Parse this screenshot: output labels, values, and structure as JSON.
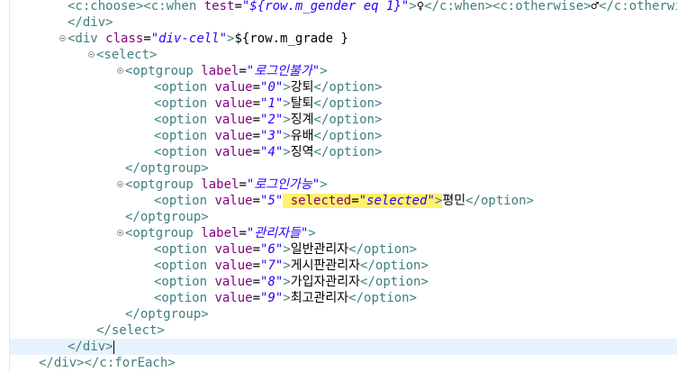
{
  "editor": {
    "lines": [
      {
        "segments": [
          {
            "t": "tag",
            "v": "<c:choose><c:when "
          },
          {
            "t": "attr",
            "v": "test"
          },
          {
            "t": "txt",
            "v": "="
          },
          {
            "t": "val",
            "v": "\"${row.m_gender eq 1}\""
          },
          {
            "t": "tag",
            "v": ">"
          },
          {
            "t": "txt",
            "v": "♀"
          },
          {
            "t": "tag",
            "v": "</c:when><c:otherwise>"
          },
          {
            "t": "txt",
            "v": "♂"
          },
          {
            "t": "tag",
            "v": "</c:otherwise>"
          }
        ]
      },
      {
        "segments": [
          {
            "t": "tag",
            "v": "</div>"
          }
        ]
      },
      {
        "segments": [
          {
            "t": "tag",
            "v": "<div "
          },
          {
            "t": "attr",
            "v": "class"
          },
          {
            "t": "txt",
            "v": "="
          },
          {
            "t": "val",
            "v": "\"div-cell\""
          },
          {
            "t": "tag",
            "v": ">"
          },
          {
            "t": "txt",
            "v": "${row.m_grade }"
          }
        ]
      },
      {
        "segments": [
          {
            "t": "tag",
            "v": "<select>"
          }
        ]
      },
      {
        "segments": [
          {
            "t": "tag",
            "v": "<optgroup "
          },
          {
            "t": "attr",
            "v": "label"
          },
          {
            "t": "txt",
            "v": "="
          },
          {
            "t": "val",
            "v": "\"로그인불가\""
          },
          {
            "t": "tag",
            "v": ">"
          }
        ]
      },
      {
        "segments": [
          {
            "t": "tag",
            "v": "<option "
          },
          {
            "t": "attr",
            "v": "value"
          },
          {
            "t": "txt",
            "v": "="
          },
          {
            "t": "val",
            "v": "\"0\""
          },
          {
            "t": "tag",
            "v": ">"
          },
          {
            "t": "txt",
            "v": "강퇴"
          },
          {
            "t": "tag",
            "v": "</option>"
          }
        ]
      },
      {
        "segments": [
          {
            "t": "tag",
            "v": "<option "
          },
          {
            "t": "attr",
            "v": "value"
          },
          {
            "t": "txt",
            "v": "="
          },
          {
            "t": "val",
            "v": "\"1\""
          },
          {
            "t": "tag",
            "v": ">"
          },
          {
            "t": "txt",
            "v": "탈퇴"
          },
          {
            "t": "tag",
            "v": "</option>"
          }
        ]
      },
      {
        "segments": [
          {
            "t": "tag",
            "v": "<option "
          },
          {
            "t": "attr",
            "v": "value"
          },
          {
            "t": "txt",
            "v": "="
          },
          {
            "t": "val",
            "v": "\"2\""
          },
          {
            "t": "tag",
            "v": ">"
          },
          {
            "t": "txt",
            "v": "징계"
          },
          {
            "t": "tag",
            "v": "</option>"
          }
        ]
      },
      {
        "segments": [
          {
            "t": "tag",
            "v": "<option "
          },
          {
            "t": "attr",
            "v": "value"
          },
          {
            "t": "txt",
            "v": "="
          },
          {
            "t": "val",
            "v": "\"3\""
          },
          {
            "t": "tag",
            "v": ">"
          },
          {
            "t": "txt",
            "v": "유배"
          },
          {
            "t": "tag",
            "v": "</option>"
          }
        ]
      },
      {
        "segments": [
          {
            "t": "tag",
            "v": "<option "
          },
          {
            "t": "attr",
            "v": "value"
          },
          {
            "t": "txt",
            "v": "="
          },
          {
            "t": "val",
            "v": "\"4\""
          },
          {
            "t": "tag",
            "v": ">"
          },
          {
            "t": "txt",
            "v": "징역"
          },
          {
            "t": "tag",
            "v": "</option>"
          }
        ]
      },
      {
        "segments": [
          {
            "t": "tag",
            "v": "</optgroup>"
          }
        ]
      },
      {
        "segments": [
          {
            "t": "tag",
            "v": "<optgroup "
          },
          {
            "t": "attr",
            "v": "label"
          },
          {
            "t": "txt",
            "v": "="
          },
          {
            "t": "val",
            "v": "\"로그인가능\""
          },
          {
            "t": "tag",
            "v": ">"
          }
        ]
      },
      {
        "segments": [
          {
            "t": "tag",
            "v": "<option "
          },
          {
            "t": "attr",
            "v": "value"
          },
          {
            "t": "txt",
            "v": "="
          },
          {
            "t": "val",
            "v": "\"5\""
          },
          {
            "t": "attr",
            "v": " selected",
            "hl": true
          },
          {
            "t": "txt",
            "v": "=",
            "hl": true
          },
          {
            "t": "val",
            "v": "\"selected\"",
            "hl": true
          },
          {
            "t": "tag",
            "v": ">",
            "hl": true
          },
          {
            "t": "txt",
            "v": "평민"
          },
          {
            "t": "tag",
            "v": "</option>"
          }
        ]
      },
      {
        "segments": [
          {
            "t": "tag",
            "v": "</optgroup>"
          }
        ]
      },
      {
        "segments": [
          {
            "t": "tag",
            "v": "<optgroup "
          },
          {
            "t": "attr",
            "v": "label"
          },
          {
            "t": "txt",
            "v": "="
          },
          {
            "t": "val",
            "v": "\"관리자들\""
          },
          {
            "t": "tag",
            "v": ">"
          }
        ]
      },
      {
        "segments": [
          {
            "t": "tag",
            "v": "<option "
          },
          {
            "t": "attr",
            "v": "value"
          },
          {
            "t": "txt",
            "v": "="
          },
          {
            "t": "val",
            "v": "\"6\""
          },
          {
            "t": "tag",
            "v": ">"
          },
          {
            "t": "txt",
            "v": "일반관리자"
          },
          {
            "t": "tag",
            "v": "</option>"
          }
        ]
      },
      {
        "segments": [
          {
            "t": "tag",
            "v": "<option "
          },
          {
            "t": "attr",
            "v": "value"
          },
          {
            "t": "txt",
            "v": "="
          },
          {
            "t": "val",
            "v": "\"7\""
          },
          {
            "t": "tag",
            "v": ">"
          },
          {
            "t": "txt",
            "v": "게시판관리자"
          },
          {
            "t": "tag",
            "v": "</option>"
          }
        ]
      },
      {
        "segments": [
          {
            "t": "tag",
            "v": "<option "
          },
          {
            "t": "attr",
            "v": "value"
          },
          {
            "t": "txt",
            "v": "="
          },
          {
            "t": "val",
            "v": "\"8\""
          },
          {
            "t": "tag",
            "v": ">"
          },
          {
            "t": "txt",
            "v": "가입자관리자"
          },
          {
            "t": "tag",
            "v": "</option>"
          }
        ]
      },
      {
        "segments": [
          {
            "t": "tag",
            "v": "<option "
          },
          {
            "t": "attr",
            "v": "value"
          },
          {
            "t": "txt",
            "v": "="
          },
          {
            "t": "val",
            "v": "\"9\""
          },
          {
            "t": "tag",
            "v": ">"
          },
          {
            "t": "txt",
            "v": "최고관리자"
          },
          {
            "t": "tag",
            "v": "</option>"
          }
        ]
      },
      {
        "segments": [
          {
            "t": "tag",
            "v": "</optgroup>"
          }
        ]
      },
      {
        "segments": [
          {
            "t": "tag",
            "v": "</select>"
          }
        ]
      },
      {
        "segments": [
          {
            "t": "tag",
            "v": "</div>"
          }
        ]
      },
      {
        "segments": [
          {
            "t": "tag",
            "v": "</div></c:forEach>"
          }
        ]
      }
    ]
  }
}
